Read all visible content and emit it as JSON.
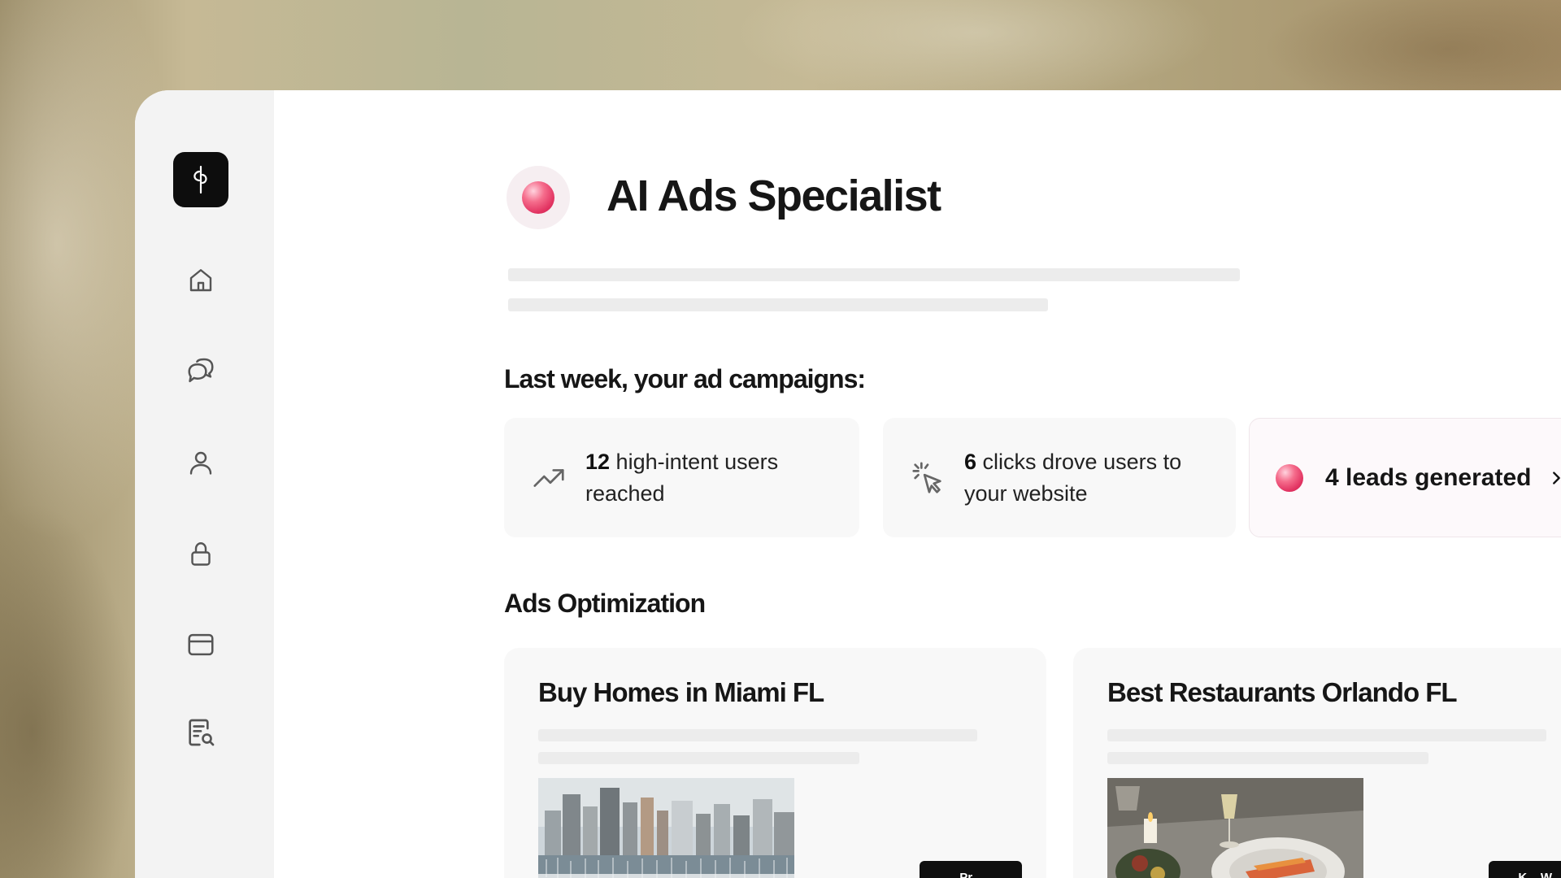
{
  "app": {
    "title": "AI Ads Specialist"
  },
  "sidebar": {
    "items": [
      {
        "name": "home",
        "icon": "home-icon"
      },
      {
        "name": "chat",
        "icon": "chat-bubbles-icon"
      },
      {
        "name": "profile",
        "icon": "user-icon"
      },
      {
        "name": "security",
        "icon": "lock-icon"
      },
      {
        "name": "billing",
        "icon": "card-icon"
      },
      {
        "name": "reports",
        "icon": "document-search-icon"
      }
    ]
  },
  "summary": {
    "heading": "Last week, your ad campaigns:",
    "stats": [
      {
        "number": "12",
        "text": " high-intent users reached",
        "icon": "trending-up-icon"
      },
      {
        "number": "6",
        "text": " clicks drove users to your website",
        "icon": "cursor-click-icon"
      }
    ],
    "leads": {
      "label": "4 leads generated",
      "icon": "chevron-right-icon"
    }
  },
  "optimization": {
    "heading": "Ads Optimization",
    "cards": [
      {
        "title": "Buy Homes in Miami FL",
        "button": "Pr..."
      },
      {
        "title": "Best Restaurants Orlando FL",
        "button": "K... W..."
      }
    ]
  },
  "colors": {
    "accent": "#e23462",
    "logo_bg": "#0d0d0d",
    "sidebar_bg": "#f3f3f3"
  }
}
